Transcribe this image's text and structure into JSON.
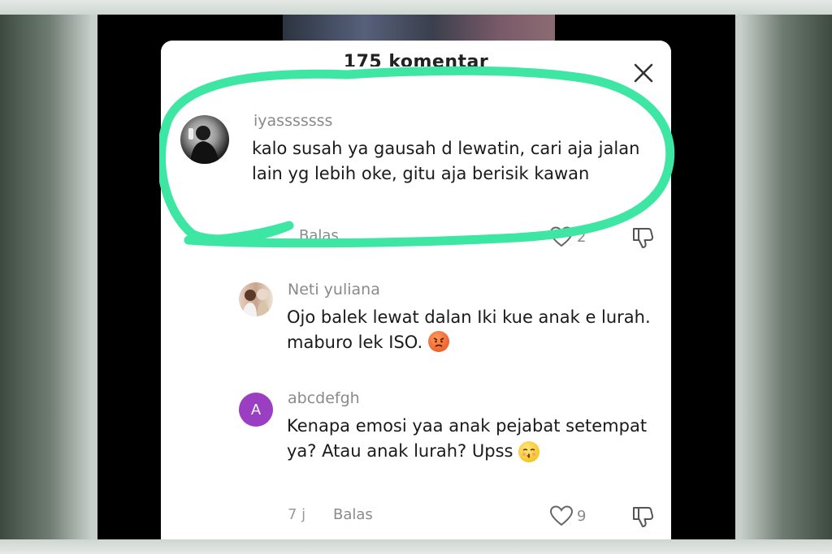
{
  "header": {
    "title": "175 komentar",
    "close_icon": "close-icon"
  },
  "comments": [
    {
      "username": "iyasssssss",
      "text": "kalo susah ya gausah d lewatin, cari aja jalan lain yg lebih oke, gitu aja berisik kawan",
      "time": "7j",
      "reply_label": "Balas",
      "likes": "2"
    },
    {
      "username": "Neti yuliana",
      "text": "Ojo balek lewat dalan Iki kue anak e lurah. maburo lek ISO.",
      "emoji": "angry-face-emoji"
    },
    {
      "username": "abcdefgh",
      "avatar_letter": "A",
      "text": "Kenapa emosi yaa anak pejabat setempat ya? Atau anak lurah? Upss",
      "emoji": "kissing-face-emoji",
      "time": "7 j",
      "reply_label": "Balas",
      "likes": "9"
    }
  ],
  "colors": {
    "highlight": "#3ee6a3",
    "avatar_purple": "#9b3fc2"
  }
}
